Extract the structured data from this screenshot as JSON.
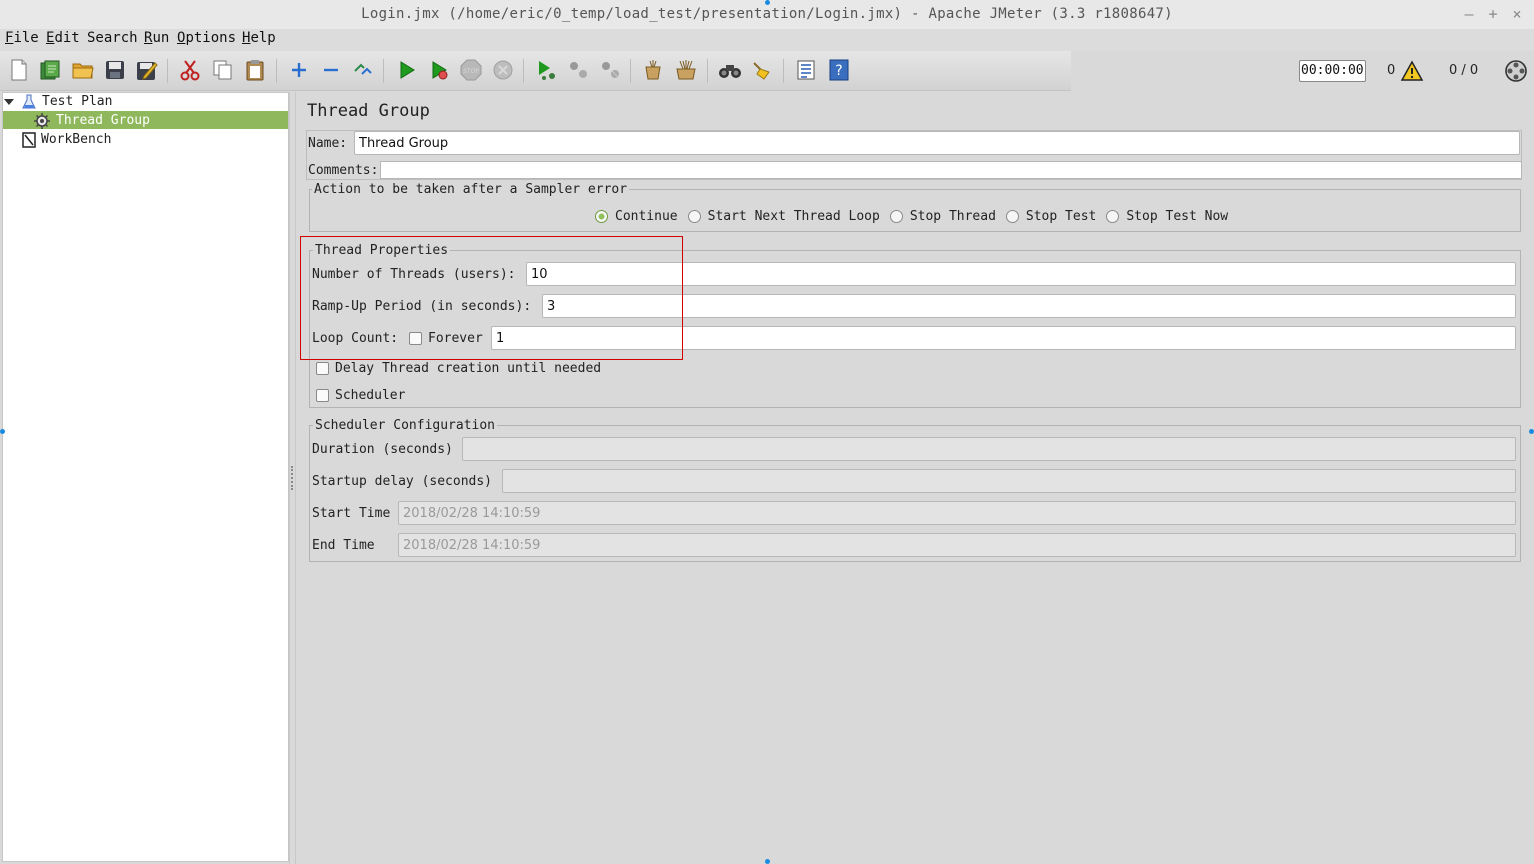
{
  "window": {
    "title": "Login.jmx (/home/eric/0_temp/load_test/presentation/Login.jmx) - Apache JMeter (3.3 r1808647)",
    "minimize": "–",
    "maximize": "+",
    "close": "×"
  },
  "menu": [
    {
      "key": "F",
      "rest": "ile"
    },
    {
      "key": "E",
      "rest": "dit"
    },
    {
      "key": "",
      "rest": "Search"
    },
    {
      "key": "R",
      "rest": "un"
    },
    {
      "key": "O",
      "rest": "ptions"
    },
    {
      "key": "H",
      "rest": "elp"
    }
  ],
  "status": {
    "timer": "00:00:00",
    "warnings": "0",
    "threads": "0 / 0"
  },
  "tree": {
    "test_plan": "Test Plan",
    "thread_group": "Thread Group",
    "workbench": "WorkBench"
  },
  "thread_group": {
    "heading": "Thread Group",
    "name_label": "Name:",
    "name_value": "Thread Group",
    "comments_label": "Comments:",
    "comments_value": "",
    "error_action": {
      "legend": "Action to be taken after a Sampler error",
      "options": [
        "Continue",
        "Start Next Thread Loop",
        "Stop Thread",
        "Stop Test",
        "Stop Test Now"
      ],
      "selected": "Continue"
    },
    "properties": {
      "legend": "Thread Properties",
      "threads_label": "Number of Threads (users):",
      "threads_value": "10",
      "rampup_label": "Ramp-Up Period (in seconds):",
      "rampup_value": "3",
      "loop_label": "Loop Count:",
      "forever_label": "Forever",
      "loop_value": "1",
      "delay_label": "Delay Thread creation until needed",
      "scheduler_label": "Scheduler"
    },
    "scheduler": {
      "legend": "Scheduler Configuration",
      "duration_label": "Duration (seconds)",
      "duration_value": "",
      "startup_label": "Startup delay (seconds)",
      "startup_value": "",
      "start_label": "Start Time",
      "start_value": "2018/02/28 14:10:59",
      "end_label": "End Time",
      "end_value": "2018/02/28 14:10:59"
    }
  },
  "colors": {
    "selection": "#8fb85c",
    "highlight": "#d40000",
    "run_green": "#1f9a1f"
  }
}
